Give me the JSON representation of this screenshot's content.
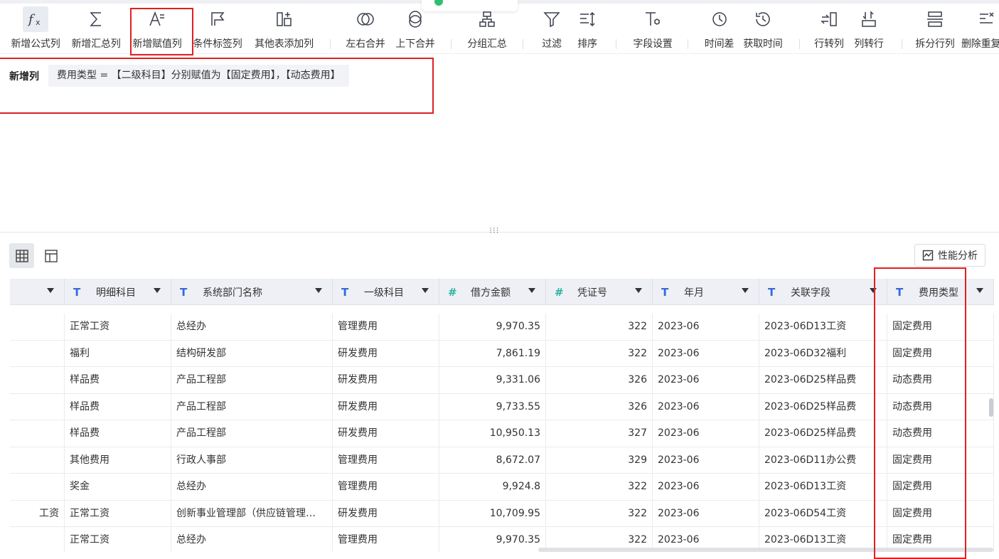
{
  "toolbar": {
    "items": [
      {
        "label": "新增公式列",
        "icon": "fx-icon"
      },
      {
        "label": "新增汇总列",
        "icon": "sigma-icon"
      },
      {
        "label": "新增赋值列",
        "icon": "assign-value-icon"
      },
      {
        "label": "条件标签列",
        "icon": "flag-icon"
      },
      {
        "label": "其他表添加列",
        "icon": "add-column-icon"
      },
      {
        "label": "左右合并",
        "icon": "merge-horizontal-icon"
      },
      {
        "label": "上下合并",
        "icon": "merge-vertical-icon"
      },
      {
        "label": "分组汇总",
        "icon": "group-icon"
      },
      {
        "label": "过滤",
        "icon": "filter-icon"
      },
      {
        "label": "排序",
        "icon": "sort-icon"
      },
      {
        "label": "字段设置",
        "icon": "field-settings-icon"
      },
      {
        "label": "时间差",
        "icon": "clock-icon"
      },
      {
        "label": "获取时间",
        "icon": "history-icon"
      },
      {
        "label": "行转列",
        "icon": "row-to-col-icon"
      },
      {
        "label": "列转行",
        "icon": "col-to-row-icon"
      },
      {
        "label": "拆分行列",
        "icon": "split-icon"
      },
      {
        "label": "删除重复",
        "icon": "dedupe-icon"
      }
    ]
  },
  "formula": {
    "label": "新增列",
    "text": "费用类型 = 【二级科目】分别赋值为【固定费用】，【动态费用】"
  },
  "view": {
    "perf_button": "性能分析"
  },
  "table": {
    "columns": [
      {
        "name": "",
        "type": ""
      },
      {
        "name": "明细科目",
        "type": "T"
      },
      {
        "name": "系统部门名称",
        "type": "T"
      },
      {
        "name": "一级科目",
        "type": "T"
      },
      {
        "name": "借方金额",
        "type": "#"
      },
      {
        "name": "凭证号",
        "type": "#"
      },
      {
        "name": "年月",
        "type": "T"
      },
      {
        "name": "关联字段",
        "type": "T"
      },
      {
        "name": "费用类型",
        "type": "T"
      }
    ],
    "rows": [
      [
        "",
        "正常工资",
        "总经办",
        "管理费用",
        "9,970.35",
        "322",
        "2023-06",
        "2023-06D13工资",
        "固定费用"
      ],
      [
        "",
        "福利",
        "结构研发部",
        "研发费用",
        "7,861.19",
        "322",
        "2023-06",
        "2023-06D32福利",
        "固定费用"
      ],
      [
        "",
        "样品费",
        "产品工程部",
        "研发费用",
        "9,331.06",
        "326",
        "2023-06",
        "2023-06D25样品费",
        "动态费用"
      ],
      [
        "",
        "样品费",
        "产品工程部",
        "研发费用",
        "9,733.55",
        "326",
        "2023-06",
        "2023-06D25样品费",
        "动态费用"
      ],
      [
        "",
        "样品费",
        "产品工程部",
        "研发费用",
        "10,950.13",
        "327",
        "2023-06",
        "2023-06D25样品费",
        "动态费用"
      ],
      [
        "",
        "其他费用",
        "行政人事部",
        "管理费用",
        "8,672.07",
        "329",
        "2023-06",
        "2023-06D11办公费",
        "固定费用"
      ],
      [
        "",
        "奖金",
        "总经办",
        "管理费用",
        "9,924.8",
        "322",
        "2023-06",
        "2023-06D13工资",
        "固定费用"
      ],
      [
        "工资",
        "正常工资",
        "创新事业管理部（供应链管理…",
        "研发费用",
        "10,709.95",
        "322",
        "2023-06",
        "2023-06D54工资",
        "固定费用"
      ],
      [
        "",
        "正常工资",
        "总经办",
        "管理费用",
        "9,970.35",
        "322",
        "2023-06",
        "2023-06D13工资",
        "固定费用"
      ]
    ]
  }
}
